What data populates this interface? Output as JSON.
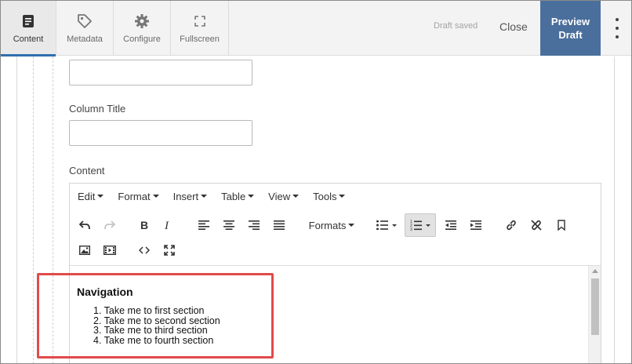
{
  "topbar": {
    "tabs": [
      {
        "label": "Content",
        "icon": "content-icon"
      },
      {
        "label": "Metadata",
        "icon": "tag-icon"
      },
      {
        "label": "Configure",
        "icon": "gear-icon"
      },
      {
        "label": "Fullscreen",
        "icon": "fullscreen-icon"
      }
    ],
    "status": "Draft saved",
    "close_label": "Close",
    "preview_label_line1": "Preview",
    "preview_label_line2": "Draft",
    "preview_color": "#4a6f9c",
    "active_tab_accent": "#2f6fb0"
  },
  "form": {
    "column_title_label": "Column Title",
    "content_label": "Content"
  },
  "editor": {
    "menus": [
      "Edit",
      "Format",
      "Insert",
      "Table",
      "View",
      "Tools"
    ],
    "formats_label": "Formats",
    "toolbar_row1": [
      "undo-icon",
      "redo-icon",
      "bold-icon",
      "italic-icon",
      "align-left-icon",
      "align-center-icon",
      "align-right-icon",
      "align-justify-icon",
      "formats-dropdown",
      "bullet-list-icon",
      "numbered-list-icon",
      "outdent-icon",
      "indent-icon",
      "link-icon",
      "unlink-icon",
      "bookmark-icon"
    ],
    "toolbar_row2": [
      "image-icon",
      "media-icon",
      "source-code-icon",
      "fullscreen-icon"
    ],
    "document": {
      "heading": "Navigation",
      "items": [
        "1. Take me to first section",
        "2. Take me to second section",
        "3. Take me to third section",
        "4. Take me to fourth section"
      ]
    }
  },
  "annotation": {
    "highlight_color": "#e14b4b"
  }
}
